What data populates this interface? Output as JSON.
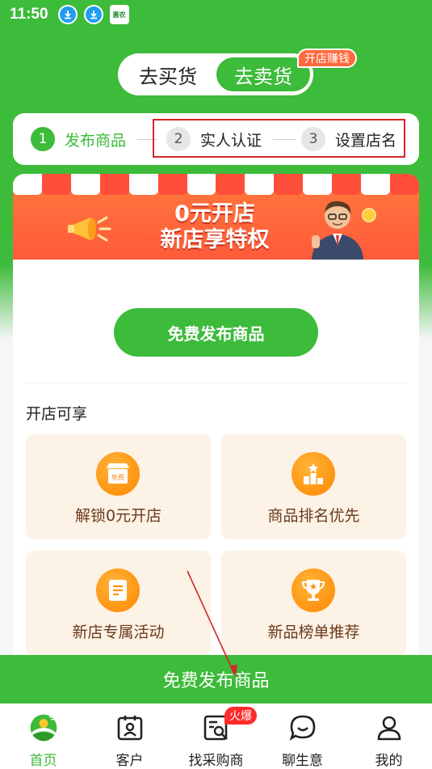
{
  "status_bar": {
    "time": "11:50",
    "app_icon_text": "惠农"
  },
  "toggle": {
    "buy_label": "去买货",
    "sell_label": "去卖货",
    "badge": "开店赚钱"
  },
  "steps": [
    {
      "num": "1",
      "label": "发布商品"
    },
    {
      "num": "2",
      "label": "实人认证"
    },
    {
      "num": "3",
      "label": "设置店名"
    }
  ],
  "banner": {
    "line1": "0元开店",
    "line2": "新店享特权"
  },
  "publish_button": "免费发布商品",
  "perks": {
    "title": "开店可享",
    "items": [
      {
        "label": "解锁0元开店",
        "icon": "free-store-icon",
        "icon_text": "免费"
      },
      {
        "label": "商品排名优先",
        "icon": "ranking-icon"
      },
      {
        "label": "新店专属活动",
        "icon": "document-icon"
      },
      {
        "label": "新品榜单推荐",
        "icon": "trophy-icon"
      }
    ]
  },
  "cta_bar": "免费发布商品",
  "tabs": [
    {
      "label": "首页",
      "icon": "home-logo-icon",
      "active": true
    },
    {
      "label": "客户",
      "icon": "contacts-icon"
    },
    {
      "label": "找采购商",
      "icon": "search-buyer-icon",
      "badge": "火爆"
    },
    {
      "label": "聊生意",
      "icon": "chat-icon"
    },
    {
      "label": "我的",
      "icon": "profile-icon"
    }
  ],
  "colors": {
    "brand_green": "#3dbb3a",
    "banner_orange": "#ff5a3a",
    "annotation_red": "#d6262a",
    "perk_bg": "#fdf2e6"
  }
}
